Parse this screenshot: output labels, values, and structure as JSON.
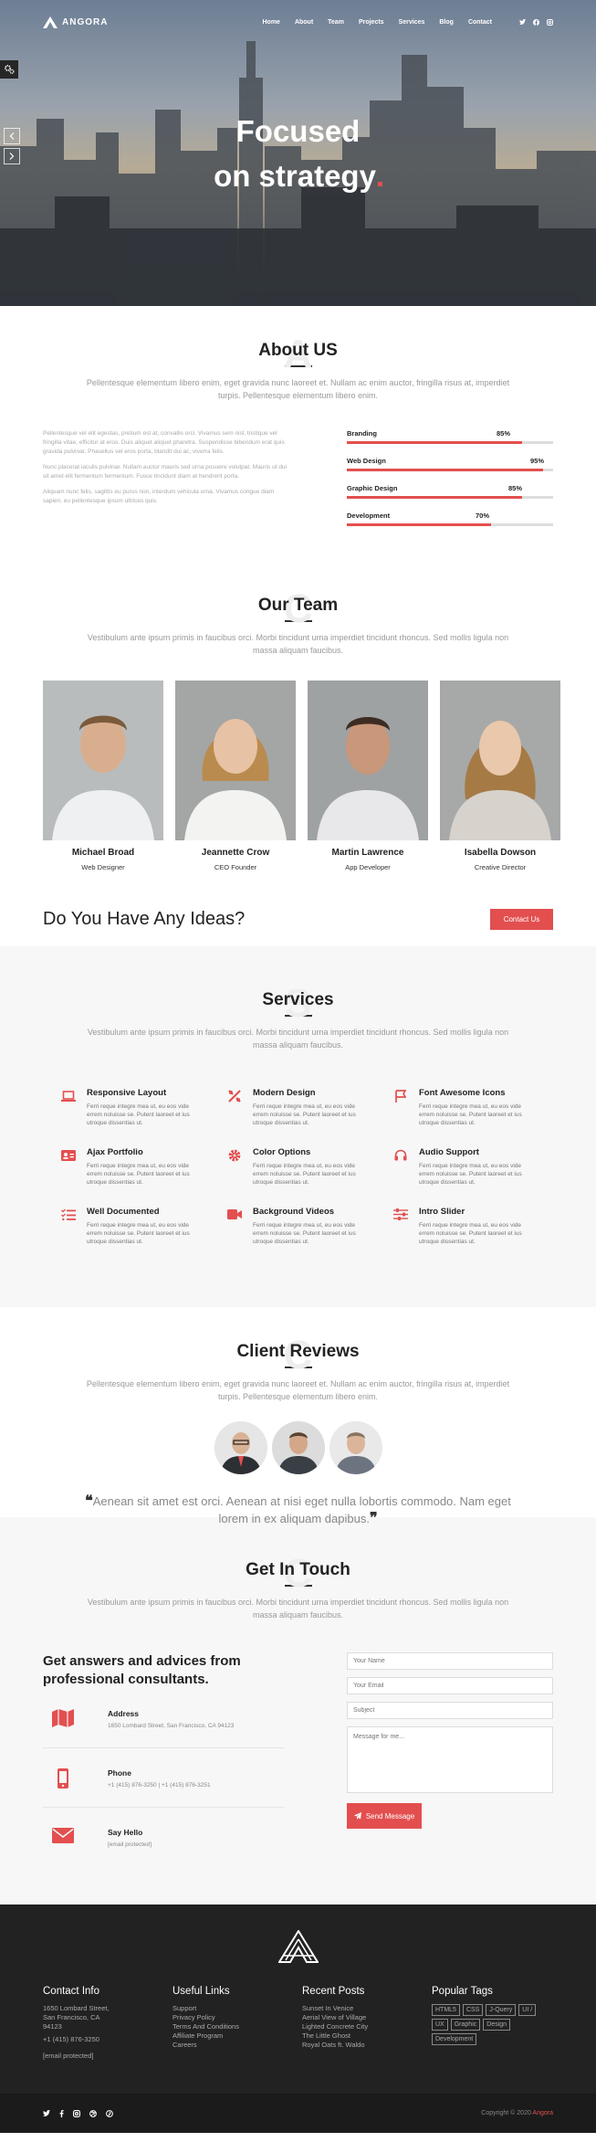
{
  "brand": {
    "name": "ANGORA"
  },
  "nav": {
    "items": [
      "Home",
      "About",
      "Team",
      "Projects",
      "Services",
      "Blog",
      "Contact"
    ]
  },
  "hero": {
    "line1": "Focused",
    "line2": "on strategy"
  },
  "about": {
    "title": "About US",
    "bg_letter": "A",
    "subtitle": "Pellentesque elementum libero enim, eget gravida nunc laoreet et. Nullam ac enim auctor, fringilla risus at, imperdiet turpis. Pellentesque elementum libero enim.",
    "paragraphs": [
      "Pellentesque vel elit egestas, pretium est at, convallis orci. Vivamus sem nisl, tristique vel fringilla vitae, efficitur at eros. Duis aliquet aliquet pharetra. Suspendisse bibendum erat quis gravida pulvinar. Phasellus vel eros porta, blandit dui ac, viverra felis.",
      "Nunc placerat iaculis pulvinar. Nullam auctor mauris sed urna posuere volutpat. Mauris ut dui sit amet elit fermentum fermentum. Fusce tincidunt diam at hendrerit porta.",
      "Aliquam nunc felis, sagittis eu purus non, interdum vehicula urna. Vivamus congue diam sapien, eu pellentesque ipsum ultrices quis."
    ],
    "skills": [
      {
        "label": "Branding",
        "pct_text": "85%",
        "value": 0.85
      },
      {
        "label": "Web Design",
        "pct_text": "95%",
        "value": 0.95
      },
      {
        "label": "Graphic Design",
        "pct_text": "85%",
        "value": 0.85
      },
      {
        "label": "Development",
        "pct_text": "70%",
        "value": 0.7
      }
    ]
  },
  "team": {
    "title": "Our Team",
    "bg_letter": "C",
    "subtitle": "Vestibulum ante ipsum primis in faucibus orci. Morbi tincidunt urna imperdiet tincidunt rhoncus. Sed mollis ligula non massa aliquam faucibus.",
    "members": [
      {
        "name": "Michael Broad",
        "role": "Web Designer"
      },
      {
        "name": "Jeannette Crow",
        "role": "CEO Founder"
      },
      {
        "name": "Martin Lawrence",
        "role": "App Developer"
      },
      {
        "name": "Isabella Dowson",
        "role": "Creative Director"
      }
    ]
  },
  "ideas": {
    "heading": "Do You Have Any Ideas?",
    "button": "Contact Us"
  },
  "services": {
    "title": "Services",
    "bg_letter": "S",
    "subtitle": "Vestibulum ante ipsum primis in faucibus orci. Morbi tincidunt urna imperdiet tincidunt rhoncus. Sed mollis ligula non massa aliquam faucibus.",
    "desc": "Ferri reque integre mea ut, eu eos vide errem noluisse se. Putent laoreet et ius utroque dissentias ut.",
    "items": [
      {
        "title": "Responsive Layout",
        "icon": "laptop-icon"
      },
      {
        "title": "Modern Design",
        "icon": "design-tools-icon"
      },
      {
        "title": "Font Awesome Icons",
        "icon": "flag-icon"
      },
      {
        "title": "Ajax Portfolio",
        "icon": "id-card-icon"
      },
      {
        "title": "Color Options",
        "icon": "gear-icon"
      },
      {
        "title": "Audio Support",
        "icon": "headphones-icon"
      },
      {
        "title": "Well Documented",
        "icon": "list-check-icon"
      },
      {
        "title": "Background Videos",
        "icon": "video-camera-icon"
      },
      {
        "title": "Intro Slider",
        "icon": "sliders-icon"
      }
    ]
  },
  "reviews": {
    "title": "Client Reviews",
    "bg_letter": "C",
    "subtitle": "Pellentesque elementum libero enim, eget gravida nunc laoreet et. Nullam ac enim auctor, fringilla risus at, imperdiet turpis. Pellentesque elementum libero enim.",
    "open_quote": "❝",
    "close_quote": "❞",
    "quote": "Aenean sit amet est orci. Aenean at nisi eget nulla lobortis commodo. Nam eget lorem in ex aliquam dapibus."
  },
  "contact": {
    "title": "Get In Touch",
    "bg_letter": "C",
    "subtitle": "Vestibulum ante ipsum primis in faucibus orci. Morbi tincidunt urna imperdiet tincidunt rhoncus. Sed mollis ligula non massa aliquam faucibus.",
    "heading": "Get answers and advices from professional consultants.",
    "items": [
      {
        "title": "Address",
        "value": "1650 Lombard Street, San Francisco, CA 94123"
      },
      {
        "title": "Phone",
        "value": "+1 (415) 876-3250 | +1 (415) 876-3251"
      },
      {
        "title": "Say Hello",
        "value": "[email protected]"
      }
    ],
    "form": {
      "name_placeholder": "Your Name",
      "email_placeholder": "Your Email",
      "subject_placeholder": "Subject",
      "message_placeholder": "Message for me...",
      "send_label": "Send Message"
    }
  },
  "footer": {
    "contact_title": "Contact Info",
    "contact_lines": [
      "1650 Lombard Street,",
      "San Francisco, CA",
      "94123",
      "+1 (415) 876-3250",
      "[email protected]"
    ],
    "links_title": "Useful Links",
    "links": [
      "Support",
      "Privacy Policy",
      "Terms And Conditions",
      "Affiliate Program",
      "Careers"
    ],
    "posts_title": "Recent Posts",
    "posts": [
      "Sunset In Venice",
      "Aerial View of Village",
      "Lighted Concrete City",
      "The Little Ghost",
      "Royal Oats ft. Waldo"
    ],
    "tags_title": "Popular Tags",
    "tags": [
      "HTML5",
      "CSS",
      "J-Query",
      "UI /",
      "UX",
      "Graphic",
      "Design",
      "Development"
    ],
    "copyright": "Copyright © 2020",
    "copyright_brand": "Angora"
  },
  "colors": {
    "accent": "#e34f4f",
    "dark": "#222222",
    "light_bg": "#f7f7f7"
  }
}
